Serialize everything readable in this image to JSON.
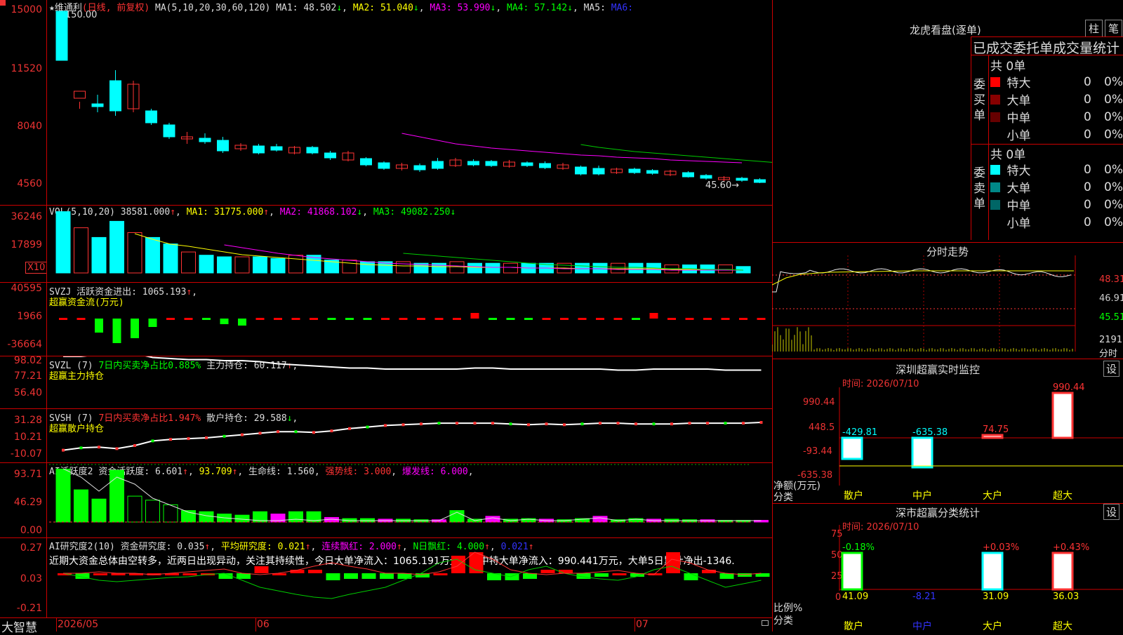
{
  "stock": {
    "name": "维通利",
    "period": "日线",
    "adj": "前复权",
    "ma_def": "MA(5,10,20,30,60,120)",
    "ma1": "48.502",
    "ma2": "51.040",
    "ma3": "53.990",
    "ma4": "57.142",
    "ma5": "MA5:",
    "ma6": "MA6:",
    "high_label": "150.00",
    "low_label": "45.60",
    "yticks": [
      "15000",
      "11520",
      "8040",
      "4560"
    ]
  },
  "vol": {
    "def": "VOL(5,10,20)",
    "val": "38581.000",
    "ma1": "31775.000",
    "ma2": "41868.102",
    "ma3": "49082.250",
    "yticks": [
      "36246",
      "17899"
    ],
    "unit": "X10",
    "bars": [
      38,
      28,
      22,
      32,
      25,
      22,
      18,
      13,
      11,
      10,
      10,
      10,
      9,
      11,
      11,
      8,
      8,
      7,
      7,
      7,
      6,
      6,
      7,
      6,
      6,
      6,
      6,
      6,
      6,
      6,
      6,
      6,
      6,
      6,
      5,
      5,
      5,
      5,
      4
    ]
  },
  "svzj": {
    "def": "SVZJ",
    "label": "活跃资金进出:",
    "val": "1065.193",
    "sub": "超赢资金流(万元)",
    "yticks": [
      "40595",
      "1966",
      "-36664"
    ],
    "vals": [
      1,
      1,
      -20,
      -35,
      -28,
      -12,
      3,
      2,
      -2,
      -8,
      -10,
      2,
      2,
      3,
      2,
      -2,
      -3,
      -2,
      1,
      2,
      1,
      1,
      2,
      8,
      -2,
      -1,
      -1,
      1,
      1,
      1,
      1,
      1,
      -1,
      8,
      1,
      1,
      1,
      1,
      1,
      1
    ]
  },
  "svzl": {
    "def": "SVZL (7)",
    "label": "7日内买卖净占比0.885%",
    "label2": "主力持仓:",
    "val": "60.117",
    "sub": "超赢主力持仓",
    "yticks": [
      "98.02",
      "77.21",
      "56.40"
    ],
    "vals": [
      80,
      80,
      82,
      88,
      83,
      79,
      78,
      77,
      77,
      76,
      76,
      75,
      73,
      72,
      71,
      70,
      69,
      69,
      68,
      68,
      68,
      68,
      68,
      69,
      69,
      68,
      68,
      68,
      68,
      68,
      68,
      67,
      67,
      68,
      68,
      68,
      68,
      67,
      67,
      67
    ]
  },
  "svsh": {
    "def": "SVSH (7)",
    "label": "7日内买卖净占比1.947%",
    "label2": "散户持仓:",
    "val": "29.588",
    "sub": "超赢散户持仓",
    "yticks": [
      "31.28",
      "10.21",
      "-10.07"
    ],
    "vals": [
      -6,
      -3,
      -2,
      -4,
      0,
      6,
      8,
      9,
      10,
      12,
      14,
      16,
      18,
      18,
      17,
      19,
      22,
      24,
      26,
      27,
      28,
      29,
      29,
      29,
      29,
      28,
      27,
      28,
      27,
      28,
      29,
      29,
      28,
      28,
      28,
      29,
      29,
      29,
      29,
      30
    ]
  },
  "ai_active": {
    "def": "AI活跃度2",
    "label": "资金活跃度:",
    "val": "6.601",
    "v2": "93.709",
    "label3": "生命线:",
    "v3": "1.560",
    "l4": "强势线:",
    "v4": "3.000",
    "l5": "爆发线:",
    "v5": "6.000",
    "yticks": [
      "93.71",
      "46.29",
      "0.00"
    ],
    "vals": [
      92,
      56,
      40,
      90,
      45,
      38,
      30,
      20,
      18,
      14,
      12,
      18,
      14,
      18,
      18,
      8,
      6,
      6,
      5,
      5,
      4,
      4,
      20,
      5,
      10,
      5,
      6,
      5,
      4,
      6,
      10,
      4,
      6,
      5,
      5,
      4,
      4,
      3,
      3,
      3
    ]
  },
  "ai_research": {
    "def": "AI研究度2(10)",
    "label": "资金研究度:",
    "val": "0.035",
    "l2": "平均研究度:",
    "v2": "0.021",
    "l3": "连续飘红:",
    "v3": "2.000",
    "l4": "N日飘红:",
    "v4": "4.000",
    "v5": "0.021",
    "note": "近期大资金总体由空转多，近两日出现异动，关注其持续性，今日大单净流入：1065.191万元，其中特大单净流入：990.441万元，大单5日累计净出-1346.",
    "yticks": [
      "0.27",
      "0.03",
      "-0.21"
    ]
  },
  "xaxis": {
    "brand": "大智慧",
    "m1": "2026/05",
    "m2": "06",
    "m3": "07"
  },
  "lhb": {
    "title": "龙虎看盘(逐单)",
    "btn1": "柱",
    "btn2": "笔",
    "subtitle": "已成交委托单成交量统计",
    "buy": {
      "side": "委买单",
      "total": "共 0单",
      "rows": [
        {
          "n": "特大",
          "v": "0",
          "p": "0%"
        },
        {
          "n": "大单",
          "v": "0",
          "p": "0%"
        },
        {
          "n": "中单",
          "v": "0",
          "p": "0%"
        },
        {
          "n": "小单",
          "v": "0",
          "p": "0%"
        }
      ]
    },
    "sell": {
      "side": "委卖单",
      "total": "共 0单",
      "rows": [
        {
          "n": "特大",
          "v": "0",
          "p": "0%"
        },
        {
          "n": "大单",
          "v": "0",
          "p": "0%"
        },
        {
          "n": "中单",
          "v": "0",
          "p": "0%"
        },
        {
          "n": "小单",
          "v": "0",
          "p": "0%"
        }
      ]
    }
  },
  "fenshi": {
    "title": "分时走势",
    "p1": "48.31",
    "p2": "46.91",
    "p3": "45.51",
    "vol": "2191",
    "unit": "分时"
  },
  "monitor": {
    "title": "深圳超赢实时监控",
    "btn": "设",
    "time": "时间: 2026/07/10",
    "yticks": [
      "990.44",
      "448.5",
      "-93.44",
      "-635.38"
    ],
    "ylab": "净额(万元)",
    "xlab": "分类",
    "cats": [
      "散户",
      "中户",
      "大户",
      "超大"
    ],
    "vals": [
      "-429.81",
      "-635.38",
      "74.75",
      "990.44"
    ]
  },
  "classify": {
    "title": "深市超赢分类统计",
    "btn": "设",
    "time": "时间: 2026/07/10",
    "yticks": [
      "75",
      "50",
      "25",
      "0"
    ],
    "ylab": "比例%",
    "xlab": "分类",
    "cats": [
      "散户",
      "中户",
      "大户",
      "超大"
    ],
    "pcts": [
      "-0.18%",
      "",
      "+0.03%",
      "+0.43%"
    ],
    "vals": [
      "41.09",
      "-8.21",
      "31.09",
      "36.03"
    ]
  }
}
